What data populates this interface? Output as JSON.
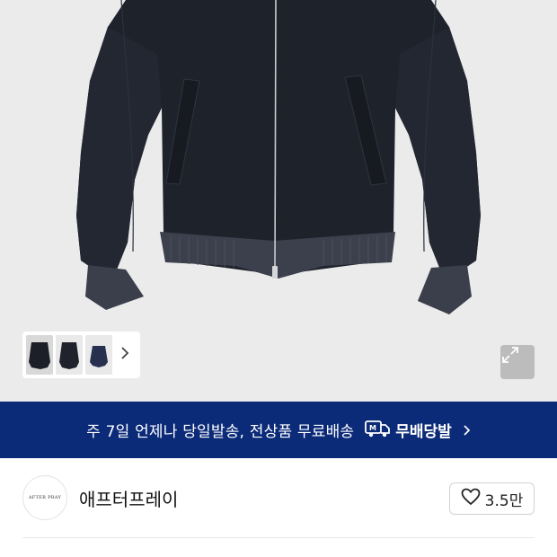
{
  "product": {
    "thumbnails": [
      {
        "name": "thumb-front",
        "selected": true
      },
      {
        "name": "thumb-angle",
        "selected": false
      },
      {
        "name": "thumb-navy",
        "selected": false
      }
    ],
    "thumb_next_icon": "chevron-right-icon",
    "expand_icon": "expand-icon"
  },
  "banner": {
    "text": "주 7일 언제나 당일발송, 전상품 무료배송",
    "badge_label": "무배당발",
    "badge_icon": "delivery-truck-icon",
    "chevron_icon": "chevron-right-icon",
    "background": "#0b2a78"
  },
  "store": {
    "logo_text": "AFTER PRAY",
    "name": "애프터프레이",
    "like_count": "3.5만",
    "like_icon": "heart-icon"
  }
}
